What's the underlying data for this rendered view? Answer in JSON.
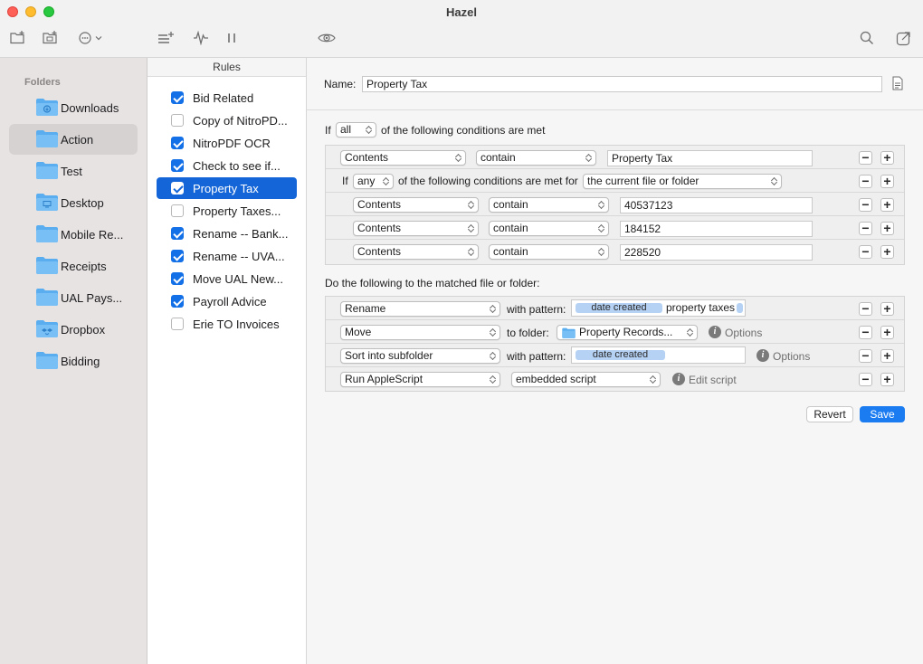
{
  "window": {
    "title": "Hazel"
  },
  "toolbar": {
    "icons": [
      "new-folder-icon",
      "folder-settings-icon",
      "more-actions-icon",
      "add-rule-icon",
      "activity-icon",
      "pause-icon",
      "preview-icon",
      "search-icon",
      "export-icon"
    ]
  },
  "sidebar": {
    "heading": "Folders",
    "items": [
      {
        "label": "Downloads",
        "icon": "downloads-folder-icon",
        "selected": false
      },
      {
        "label": "Action",
        "icon": "folder-icon",
        "selected": true
      },
      {
        "label": "Test",
        "icon": "folder-icon",
        "selected": false
      },
      {
        "label": "Desktop",
        "icon": "desktop-folder-icon",
        "selected": false
      },
      {
        "label": "Mobile Re...",
        "icon": "folder-icon",
        "selected": false
      },
      {
        "label": "Receipts",
        "icon": "folder-icon",
        "selected": false
      },
      {
        "label": "UAL Pays...",
        "icon": "folder-icon",
        "selected": false
      },
      {
        "label": "Dropbox",
        "icon": "dropbox-folder-icon",
        "selected": false
      },
      {
        "label": "Bidding",
        "icon": "folder-icon",
        "selected": false
      }
    ]
  },
  "rules": {
    "heading": "Rules",
    "items": [
      {
        "label": "Bid Related",
        "checked": true,
        "selected": false
      },
      {
        "label": "Copy of NitroPD...",
        "checked": false,
        "selected": false
      },
      {
        "label": "NitroPDF OCR",
        "checked": true,
        "selected": false
      },
      {
        "label": "Check to see if...",
        "checked": true,
        "selected": false
      },
      {
        "label": "Property Tax",
        "checked": true,
        "selected": true
      },
      {
        "label": "Property Taxes...",
        "checked": false,
        "selected": false
      },
      {
        "label": "Rename -- Bank...",
        "checked": true,
        "selected": false
      },
      {
        "label": "Rename -- UVA...",
        "checked": true,
        "selected": false
      },
      {
        "label": "Move UAL New...",
        "checked": true,
        "selected": false
      },
      {
        "label": "Payroll Advice",
        "checked": true,
        "selected": false
      },
      {
        "label": "Erie TO Invoices",
        "checked": false,
        "selected": false
      }
    ]
  },
  "editor": {
    "name_label": "Name:",
    "name_value": "Property Tax",
    "if_label": "If",
    "match_mode": "all",
    "match_suffix": "of the following conditions are met",
    "conditions": {
      "top": {
        "attribute": "Contents",
        "operator": "contain",
        "value": "Property Tax"
      },
      "nested": {
        "if_label": "If",
        "match_mode": "any",
        "suffix": "of the following conditions are met for",
        "target": "the current file or folder",
        "rows": [
          {
            "attribute": "Contents",
            "operator": "contain",
            "value": "40537123"
          },
          {
            "attribute": "Contents",
            "operator": "contain",
            "value": "184152"
          },
          {
            "attribute": "Contents",
            "operator": "contain",
            "value": "228520"
          }
        ]
      }
    },
    "actions_label": "Do the following to the matched file or folder:",
    "actions": [
      {
        "action": "Rename",
        "connector": "with pattern:",
        "tokens": [
          "date created"
        ],
        "text_after": "property taxes"
      },
      {
        "action": "Move",
        "connector": "to folder:",
        "folder": "Property Records...",
        "extra": "Options"
      },
      {
        "action": "Sort into subfolder",
        "connector": "with pattern:",
        "tokens": [
          "date created"
        ],
        "extra": "Options"
      },
      {
        "action": "Run AppleScript",
        "script_type": "embedded script",
        "extra": "Edit script"
      }
    ],
    "revert_label": "Revert",
    "save_label": "Save",
    "minus": "−",
    "plus": "+",
    "info": "i"
  },
  "colors": {
    "accent": "#1466d8",
    "token": "#b5d2f5",
    "folder": "#5aaef0"
  }
}
